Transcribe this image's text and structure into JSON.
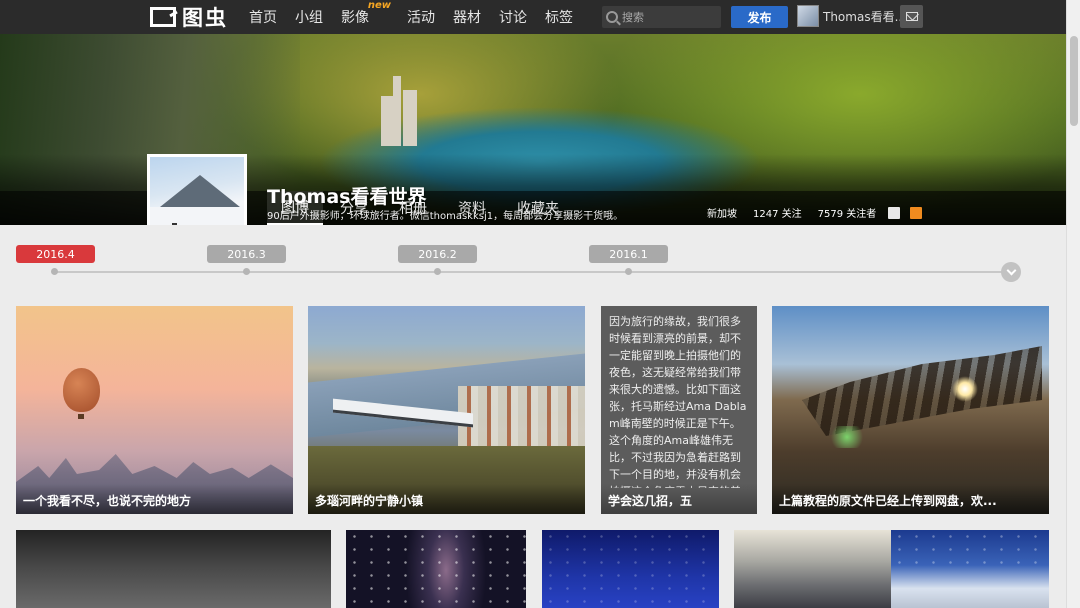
{
  "nav": {
    "logo_text": "图虫",
    "items": [
      {
        "label": "首页"
      },
      {
        "label": "小组"
      },
      {
        "label": "影像",
        "badge": "new"
      },
      {
        "label": "活动"
      },
      {
        "label": "器材"
      },
      {
        "label": "讨论"
      },
      {
        "label": "标签"
      }
    ],
    "search_placeholder": "搜索",
    "publish_label": "发布",
    "user_name": "Thomas看看...",
    "icons": [
      "search-icon",
      "mail-icon"
    ]
  },
  "profile": {
    "name": "Thomas看看世界",
    "bio": "90后户外摄影师，环球旅行者。微信thomaskksj1，每周都会分享摄影干货哦。",
    "location": "新加坡",
    "following": "1247 关注",
    "followers": "7579 关注者",
    "tabs": [
      {
        "label": "图博",
        "active": true
      },
      {
        "label": "分享",
        "active": false
      },
      {
        "label": "相册",
        "active": false
      },
      {
        "label": "资料",
        "active": false
      },
      {
        "label": "收藏夹",
        "active": false
      }
    ]
  },
  "timeline": {
    "labels": [
      "2016.4",
      "2016.3",
      "2016.2",
      "2016.1"
    ],
    "active_index": 0,
    "active_color": "#d9393c"
  },
  "cards": [
    {
      "caption": "一个我看不尽，也说不完的地方"
    },
    {
      "caption": "多瑙河畔的宁静小镇"
    },
    {
      "caption": "学会这几招，五",
      "text": "因为旅行的缘故，我们很多时候看到漂亮的前景，却不一定能留到晚上拍摄他们的夜色，这无疑经常给我们带来很大的遗憾。比如下面这张，托马斯经过Ama Dablam峰南壁的时候正是下午。这个角度的Ama峰雄伟无比，不过我因为急着赶路到下一个目的地，并没有机会拍摄这个角度雪山星空的美景。于是我把这个心中的遗憾变成了"
    },
    {
      "caption": "上篇教程的原文件已经上传到网盘，欢..."
    }
  ],
  "colors": {
    "topnav": "#2b2b2b",
    "publish": "#2a6ac8",
    "badge_new": "#f5a623"
  }
}
